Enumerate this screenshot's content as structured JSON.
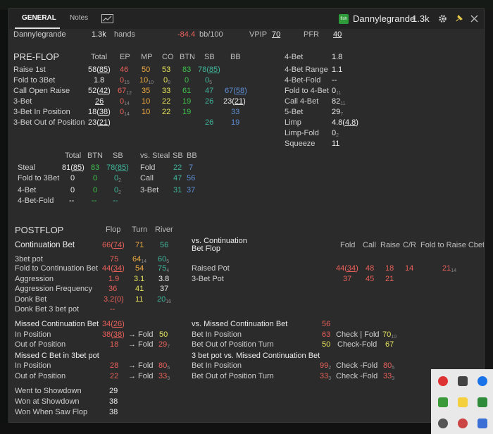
{
  "tabs": {
    "general": "GENERAL",
    "notes": "Notes"
  },
  "player": {
    "name": "Dannylegrande",
    "hands": "1.3k",
    "fish": "fish"
  },
  "summary": {
    "name": "Dannylegrande",
    "hands_val": "1.3k",
    "hands_lbl": "hands",
    "bb": "-84.4",
    "bb_lbl": "bb/100",
    "vpip_lbl": "VPIP",
    "vpip": "70",
    "pfr_lbl": "PFR",
    "pfr": "40"
  },
  "preflop": {
    "title": "PRE-FLOP",
    "headers": [
      "Total",
      "EP",
      "MP",
      "CO",
      "BTN",
      "SB",
      "BB"
    ],
    "rows": [
      {
        "label": "Raise 1st",
        "total": "58",
        "total_sub": "85",
        "ep": "46",
        "mp": "50",
        "co": "53",
        "btn": "83",
        "sb": "78",
        "sb_sub": "85",
        "bb": ""
      },
      {
        "label": "Fold to 3Bet",
        "total": "1.8",
        "ep": "0",
        "ep_s": "15",
        "mp": "10",
        "mp_s": "10",
        "co": "0",
        "co_s": "8",
        "btn": "0",
        "sb": "0",
        "sb_s": "5",
        "bb": ""
      },
      {
        "label": "Call Open Raise",
        "total": "52",
        "total_sub": "42",
        "ep": "67",
        "ep_s": "12",
        "mp": "35",
        "co": "33",
        "btn": "61",
        "sb": "47",
        "bb": "67",
        "bb_sub": "58"
      },
      {
        "label": "3-Bet",
        "total": "26",
        "ep": "0",
        "ep_s": "14",
        "mp": "10",
        "co": "22",
        "btn": "19",
        "sb": "26",
        "bb": "23",
        "bb_sub": "21"
      },
      {
        "label": "3-Bet In Position",
        "total": "18",
        "total_sub": "38",
        "ep": "0",
        "ep_s": "14",
        "mp": "10",
        "co": "22",
        "btn": "19",
        "sb": "",
        "bb": "33"
      },
      {
        "label": "3-Bet Out of Position",
        "total": "23",
        "total_sub": "21",
        "sb": "26",
        "bb": "19"
      }
    ],
    "right": [
      {
        "label": "4-Bet",
        "val": "1.8"
      },
      {
        "label": "4-Bet Range",
        "val": "1.1"
      },
      {
        "label": "4-Bet-Fold",
        "val": "--"
      },
      {
        "label": "Fold to 4-Bet",
        "val": "0",
        "sub": "11"
      },
      {
        "label": "Call 4-Bet",
        "val": "82",
        "sub": "11"
      },
      {
        "label": "5-Bet",
        "val": "29",
        "sub": "7"
      },
      {
        "label": "Limp",
        "val": "4.8",
        "val2": "4.8"
      },
      {
        "label": "Limp-Fold",
        "val": "0",
        "sub": "2"
      },
      {
        "label": "Squeeze",
        "val": "11"
      }
    ],
    "steal_headers": [
      "Total",
      "BTN",
      "SB"
    ],
    "steal_rows": [
      {
        "label": "Steal",
        "total": "81",
        "total_sub": "85",
        "btn": "83",
        "sb": "78",
        "sb_sub": "85"
      },
      {
        "label": "Fold to 3Bet",
        "total": "0",
        "btn": "0",
        "sb": "0",
        "sb_s": "2"
      },
      {
        "label": "4-Bet",
        "total": "0",
        "btn": "0",
        "sb": "0",
        "sb_s": "2"
      },
      {
        "label": "4-Bet-Fold",
        "total": "--",
        "btn": "--",
        "sb": "--"
      }
    ],
    "vs_steal_headers": [
      "vs. Steal",
      "SB",
      "BB"
    ],
    "vs_steal_rows": [
      {
        "label": "Fold",
        "sb": "22",
        "bb": "7"
      },
      {
        "label": "Call",
        "sb": "47",
        "bb": "56"
      },
      {
        "label": "3-Bet",
        "sb": "31",
        "bb": "37"
      }
    ]
  },
  "postflop": {
    "title": "POSTFLOP",
    "headers": [
      "Flop",
      "Turn",
      "River"
    ],
    "cbet_label": "Continuation Bet",
    "cbet": {
      "flop": "66",
      "flop_sub": "74",
      "turn": "71",
      "river": "56"
    },
    "rows": [
      {
        "label": "3bet pot",
        "flop": "75",
        "turn": "64",
        "turn_s": "14",
        "river": "60",
        "river_s": "5"
      },
      {
        "label": "Fold to Continuation Bet",
        "flop": "44",
        "flop_sub": "34",
        "turn": "54",
        "river": "75",
        "river_s": "4"
      },
      {
        "label": "Aggression",
        "flop": "1.9",
        "turn": "3.1",
        "river": "3.8"
      },
      {
        "label": "Aggression Frequency",
        "flop": "36",
        "turn": "41",
        "river": "37"
      },
      {
        "label": "Donk Bet",
        "flop": "3.2",
        "flop_sub": "0",
        "turn": "11",
        "river": "20",
        "river_s": "16"
      },
      {
        "label": "Donk Bet 3 bet pot",
        "flop": "--"
      }
    ],
    "vs_cbet": {
      "title1": "vs. Continuation",
      "title2": "Bet Flop",
      "headers": [
        "Fold",
        "Call",
        "Raise",
        "C/R",
        "Fold to Raise Cbet"
      ],
      "rows": [
        {
          "label": "Raised Pot",
          "fold": "44",
          "fold_sub": "34",
          "call": "48",
          "raise": "18",
          "cr": "14",
          "ftr": "21",
          "ftr_s": "14"
        },
        {
          "label": "3-Bet Pot",
          "fold": "37",
          "call": "45",
          "raise": "21"
        }
      ]
    },
    "missed": {
      "label": "Missed Continuation Bet",
      "val": "34",
      "val_sub": "26",
      "rows": [
        {
          "label": "In Position",
          "val": "38",
          "val_sub": "38",
          "arrow": "→ Fold",
          "fold": "50"
        },
        {
          "label": "Out of Position",
          "val": "18",
          "arrow": "→ Fold",
          "fold": "29",
          "fold_s": "7"
        }
      ]
    },
    "missed3": {
      "label": "Missed C Bet in 3bet pot",
      "rows": [
        {
          "label": "In Position",
          "val": "28",
          "arrow": "→ Fold",
          "fold": "80",
          "fold_s": "5"
        },
        {
          "label": "Out of Position",
          "val": "22",
          "arrow": "→ Fold",
          "fold": "33",
          "fold_s": "3"
        }
      ]
    },
    "vs_missed": {
      "label": "vs. Missed Continuation Bet",
      "val": "56",
      "rows": [
        {
          "label": "Bet In Position",
          "val": "63",
          "extra": "Check | Fold",
          "extra_val": "70",
          "extra_s": "10"
        },
        {
          "label": "Bet Out of Position Turn",
          "val": "50",
          "extra": "Check-Fold",
          "extra_val": "67"
        }
      ]
    },
    "vs_missed3": {
      "label": "3 bet pot vs. Missed Continuation Bet",
      "rows": [
        {
          "label": "Bet In Position",
          "val": "99",
          "val_s": "2",
          "extra": "Check -Fold",
          "extra_val": "80",
          "extra_s": "5"
        },
        {
          "label": "Bet Out of Position Turn",
          "val": "33",
          "val_s": "3",
          "extra": "Check -Fold",
          "extra_val": "33",
          "extra_s": "3"
        }
      ]
    },
    "showdown": [
      {
        "label": "Went to Showdown",
        "val": "29"
      },
      {
        "label": "Won at Showdown",
        "val": "38"
      },
      {
        "label": "Won When Saw Flop",
        "val": "38"
      }
    ]
  }
}
